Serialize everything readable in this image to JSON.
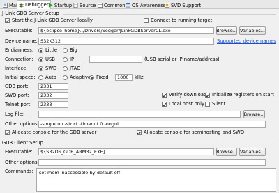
{
  "tabs": [
    {
      "label": "Main",
      "icon": "main-icon",
      "active": false
    },
    {
      "label": "Debugger",
      "icon": "debugger-icon",
      "active": true
    },
    {
      "label": "Startup",
      "icon": "startup-icon",
      "active": false
    },
    {
      "label": "Source",
      "icon": "source-icon",
      "active": false
    },
    {
      "label": "Common",
      "icon": "common-icon",
      "active": false
    },
    {
      "label": "OS Awareness",
      "icon": "os-awareness-icon",
      "active": false
    },
    {
      "label": "SVD Support",
      "icon": "svd-support-icon",
      "active": false
    }
  ],
  "server": {
    "heading": "J-Link GDB Server Setup",
    "start_locally": "Start the J-Link GDB Server locally",
    "connect_running": "Connect to running target",
    "executable_label": "Executable:",
    "executable_value": "${eclipse_home}../Drivers/Segger/JLinkGDBServerCL.exe",
    "browse": "Browse...",
    "variables": "Variables...",
    "device_label": "Device name:",
    "device_value": "S32K312",
    "supported_devices": "Supported device names",
    "endianness_label": "Endianness:",
    "endianness_options": [
      "Little",
      "Big"
    ],
    "connection_label": "Connection:",
    "connection_options": [
      "USB",
      "IP"
    ],
    "connection_hint": "(USB serial or IP name/address)",
    "interface_label": "Interface:",
    "interface_options": [
      "SWD",
      "JTAG"
    ],
    "speed_label": "Initial speed:",
    "speed_options": [
      "Auto",
      "Adaptive",
      "Fixed"
    ],
    "speed_value": "1000",
    "speed_unit": "kHz",
    "gdb_port_label": "GDB port:",
    "gdb_port_value": "2331",
    "swo_port_label": "SWO port:",
    "swo_port_value": "2332",
    "telnet_port_label": "Telnet port:",
    "telnet_port_value": "2333",
    "verify_downloads": "Verify downloads",
    "init_registers": "Initialize registers on start",
    "local_host_only": "Local host only",
    "silent": "Silent",
    "log_file_label": "Log file:",
    "log_file_value": "",
    "other_options_label": "Other options:",
    "other_options_value": "-singlerun -strict -timeout 0 -nogui",
    "allocate_gdb": "Allocate console for the GDB server",
    "allocate_semihosting": "Allocate console for semihosting and SWO"
  },
  "client": {
    "heading": "GDB Client Setup",
    "executable_label": "Executable:",
    "executable_value": "${S32DS_GDB_ARM32_EXE}",
    "browse": "Browse...",
    "variables": "Variables...",
    "other_options_label": "Other options:",
    "other_options_value": "",
    "commands_label": "Commands:",
    "commands_value": "set mem inaccessible-by-default off"
  },
  "colors": {
    "link": "#1a4fc8",
    "active_tab": "#ffffff"
  }
}
